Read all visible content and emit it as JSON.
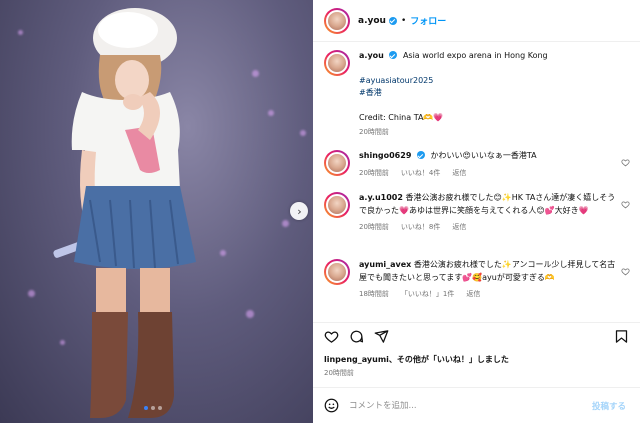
{
  "header": {
    "username": "a.you",
    "separator": "•",
    "follow_label": "フォロー"
  },
  "caption": {
    "username": "a.you",
    "text": "Asia world expo arena in Hong Kong",
    "tag1": "#ayuasiatour2025",
    "tag2": "#香港",
    "credit": "Credit: China TA🫶💗",
    "time": "20時間前"
  },
  "comments": [
    {
      "username": "shingo0629",
      "text": "かわいい😍いいなぁ一香港TA",
      "time": "20時間前",
      "likes": "いいね！4件",
      "reply": "返信"
    },
    {
      "username": "a.y.u1002",
      "text": "香港公演お疲れ様でした😊✨HK TAさん達が凄く嬉しそうで良かった💗あゆは世界に笑顔を与えてくれる人😊💕大好き💗",
      "time": "20時間前",
      "likes": "いいね！8件",
      "reply": "返信"
    },
    {
      "username": "ayumi_avex",
      "text": "香港公演お疲れ様でした✨アンコール少し拝見して名古屋でも聞きたいと思ってます💕🥰ayuが可愛すぎる🫶",
      "time": "18時間前",
      "likes": "「いいね！」1件",
      "reply": "返信"
    }
  ],
  "likes_summary": {
    "user": "linpeng_ayumi",
    "rest": "、その他が「いいね！」しました",
    "time": "20時間前"
  },
  "comment_box": {
    "placeholder": "コメントを追加...",
    "post_label": "投稿する"
  },
  "icons": [
    "heart-icon",
    "comment-icon",
    "share-icon",
    "bookmark-icon",
    "smiley-icon",
    "chevron-right-icon",
    "verified-icon"
  ],
  "colors": {
    "accent": "#0095f6",
    "hashtag": "#00376b",
    "muted": "#737373"
  }
}
